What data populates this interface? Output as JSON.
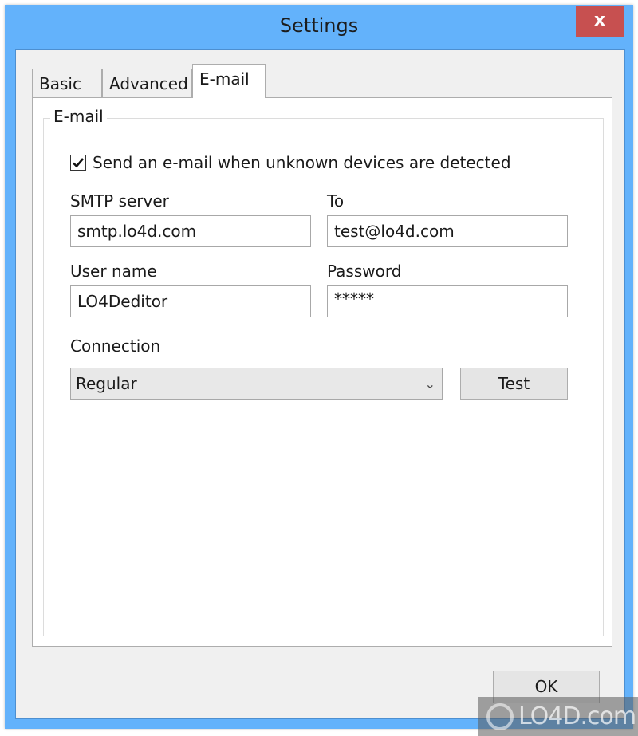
{
  "window": {
    "title": "Settings",
    "close_label": "x"
  },
  "tabs": [
    {
      "label": "Basic",
      "active": false
    },
    {
      "label": "Advanced",
      "active": false
    },
    {
      "label": "E-mail",
      "active": true
    }
  ],
  "email": {
    "group_title": "E-mail",
    "send_email_checkbox": {
      "label": "Send an e-mail when unknown devices are detected",
      "checked": true
    },
    "smtp_server": {
      "label": "SMTP server",
      "value": "smtp.lo4d.com"
    },
    "to": {
      "label": "To",
      "value": "test@lo4d.com"
    },
    "user_name": {
      "label": "User name",
      "value": "LO4Deditor"
    },
    "password": {
      "label": "Password",
      "value": "*****"
    },
    "connection": {
      "label": "Connection",
      "selected": "Regular"
    },
    "test_button": "Test"
  },
  "footer": {
    "ok_button": "OK"
  },
  "watermark": {
    "text": "LO4D.com"
  },
  "colors": {
    "titlebar": "#63b2fb",
    "close_button": "#c75050",
    "client_bg": "#f0f0f0"
  }
}
